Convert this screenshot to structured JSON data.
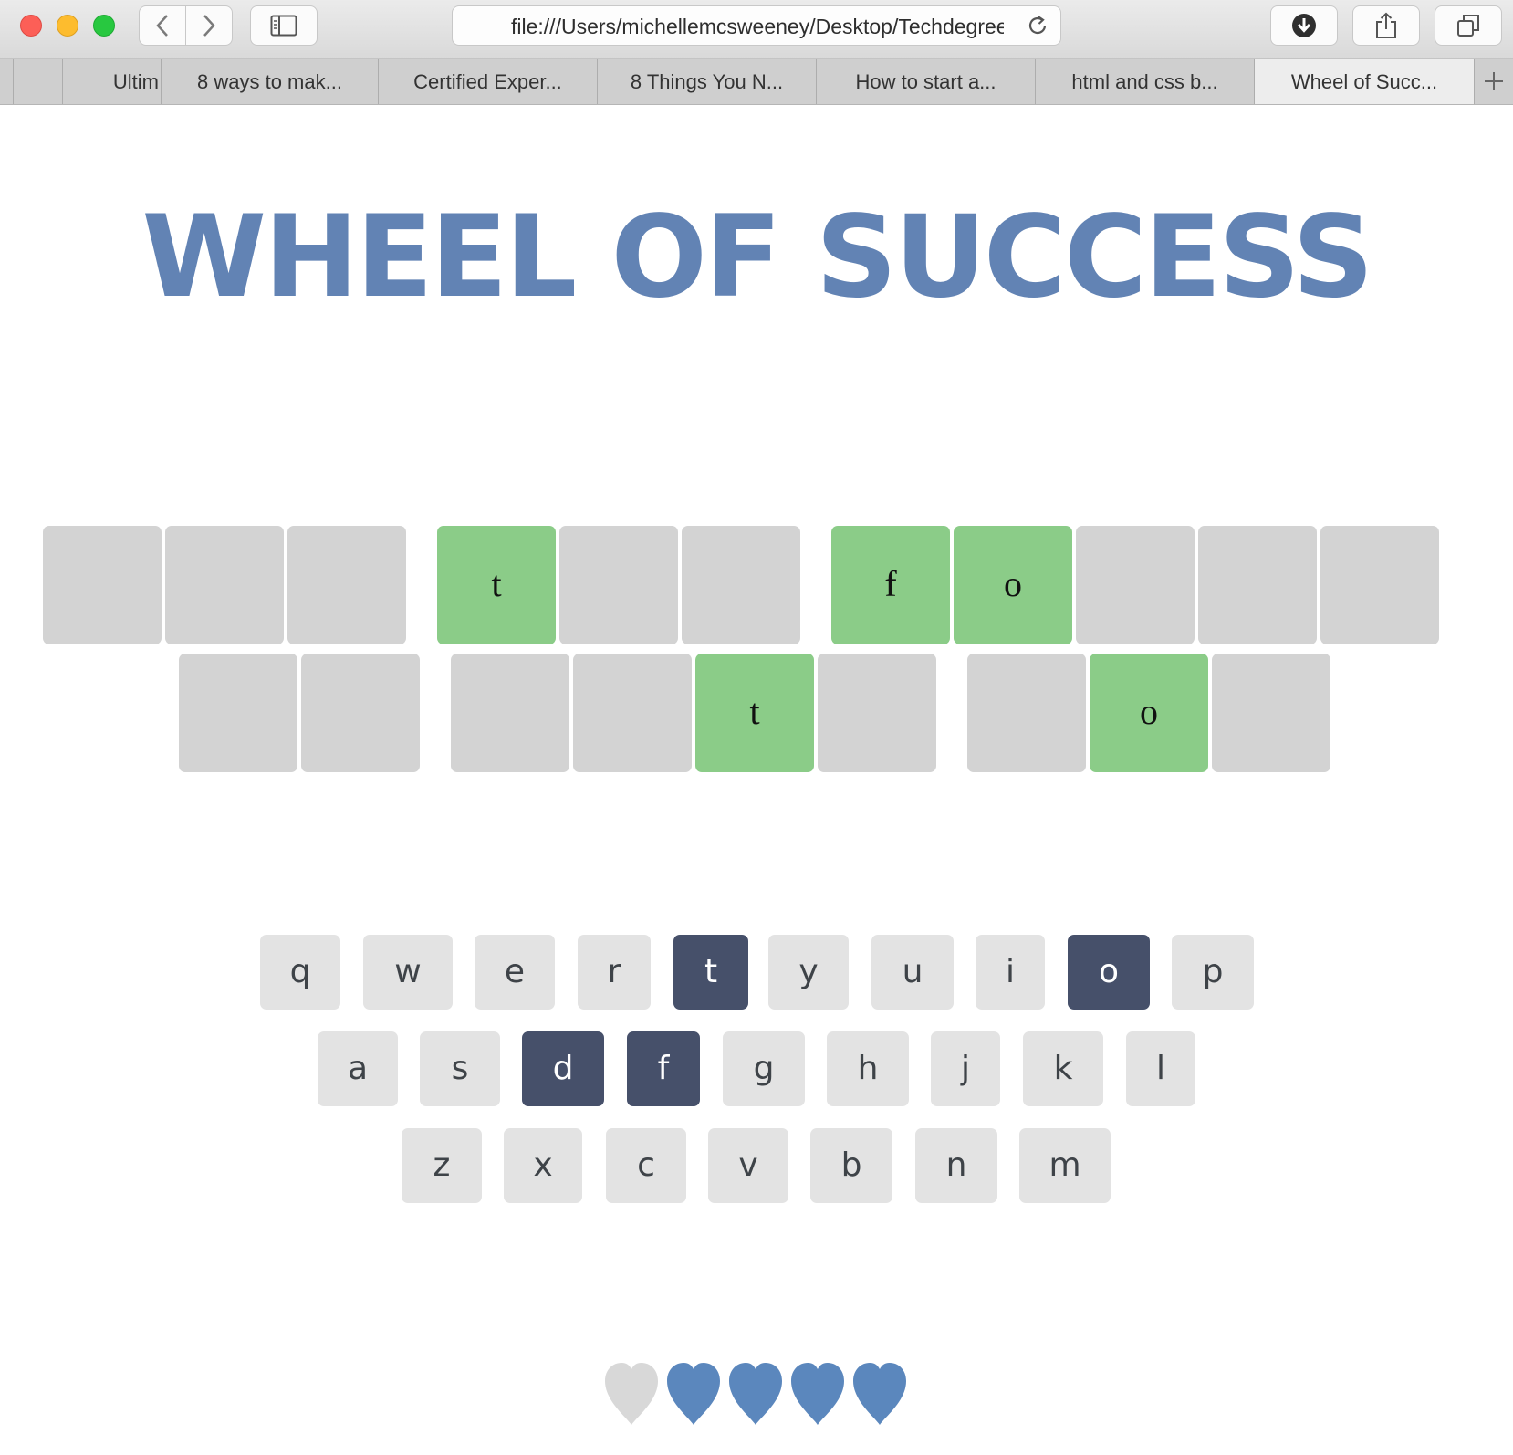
{
  "browser": {
    "url": "file:///Users/michellemcsweeney/Desktop/Techdegree",
    "tabs": [
      {
        "label": "",
        "active": false
      },
      {
        "label": "Ultim",
        "active": false
      },
      {
        "label": "8 ways to mak...",
        "active": false
      },
      {
        "label": "Certified Exper...",
        "active": false
      },
      {
        "label": "8 Things You N...",
        "active": false
      },
      {
        "label": "How to start a...",
        "active": false
      },
      {
        "label": "html and css b...",
        "active": false
      },
      {
        "label": "Wheel of Succ...",
        "active": true
      }
    ],
    "icons": {
      "back": "chevron-left-icon",
      "forward": "chevron-right-icon",
      "sidebar": "sidebar-icon",
      "reload": "reload-icon",
      "download": "download-icon",
      "share": "share-icon",
      "tabs": "tabs-overview-icon",
      "new_tab": "plus-icon"
    }
  },
  "game": {
    "title": "WHEEL OF SUCCESS",
    "phrase": {
      "row1": [
        "",
        "",
        "",
        null,
        "t",
        "",
        "",
        null,
        "f",
        "o",
        "",
        "",
        ""
      ],
      "row2": [
        "",
        "",
        null,
        "",
        "",
        "t",
        "",
        null,
        "",
        "o",
        ""
      ]
    },
    "keyboard": {
      "row1": [
        "q",
        "w",
        "e",
        "r",
        "t",
        "y",
        "u",
        "i",
        "o",
        "p"
      ],
      "row2": [
        "a",
        "s",
        "d",
        "f",
        "g",
        "h",
        "j",
        "k",
        "l"
      ],
      "row3": [
        "z",
        "x",
        "c",
        "v",
        "b",
        "n",
        "m"
      ],
      "chosen": [
        "t",
        "o",
        "d",
        "f"
      ]
    },
    "lives": {
      "total": 5,
      "lost": 1,
      "remaining": 4
    },
    "colors": {
      "title": "#6283b4",
      "tile_hidden": "#d3d3d3",
      "tile_revealed": "#8bcc88",
      "key": "#e3e3e3",
      "key_chosen": "#46506a",
      "heart_live": "#5b87bd",
      "heart_lost": "#d8d8d8"
    }
  }
}
